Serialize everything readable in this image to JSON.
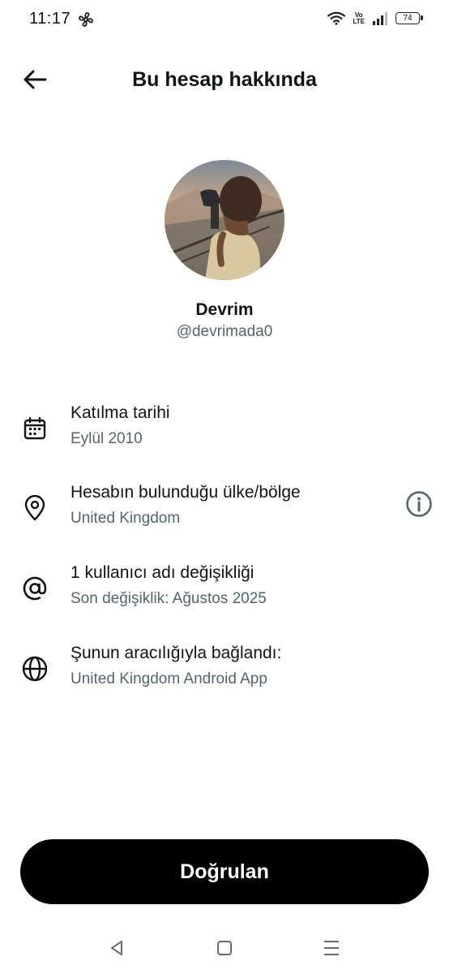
{
  "status_bar": {
    "time": "11:17",
    "network_label_top": "Vo",
    "network_label_bottom": "LTE",
    "battery": "74"
  },
  "header": {
    "title": "Bu hesap hakkında",
    "back_icon": "arrow-left-icon"
  },
  "profile": {
    "display_name": "Devrim",
    "handle": "@devrimada0"
  },
  "info_rows": [
    {
      "icon": "calendar-icon",
      "title": "Katılma tarihi",
      "subtitle": "Eylül 2010"
    },
    {
      "icon": "location-pin-icon",
      "title": "Hesabın bulunduğu ülke/bölge",
      "subtitle": "United Kingdom",
      "action_icon": "info-circle-icon"
    },
    {
      "icon": "at-sign-icon",
      "title": "1 kullanıcı adı değişikliği",
      "subtitle": "Son değişiklik: Ağustos 2025"
    },
    {
      "icon": "globe-icon",
      "title": "Şunun aracılığıyla bağlandı:",
      "subtitle": "United Kingdom Android App"
    }
  ],
  "verify_button": {
    "label": "Doğrulan"
  },
  "system_nav": {
    "back": "triangle-back-icon",
    "home": "square-home-icon",
    "recents": "menu-lines-icon"
  },
  "colors": {
    "text_primary": "#0f1419",
    "text_secondary": "#536471",
    "button_bg": "#000000",
    "button_text": "#ffffff"
  }
}
